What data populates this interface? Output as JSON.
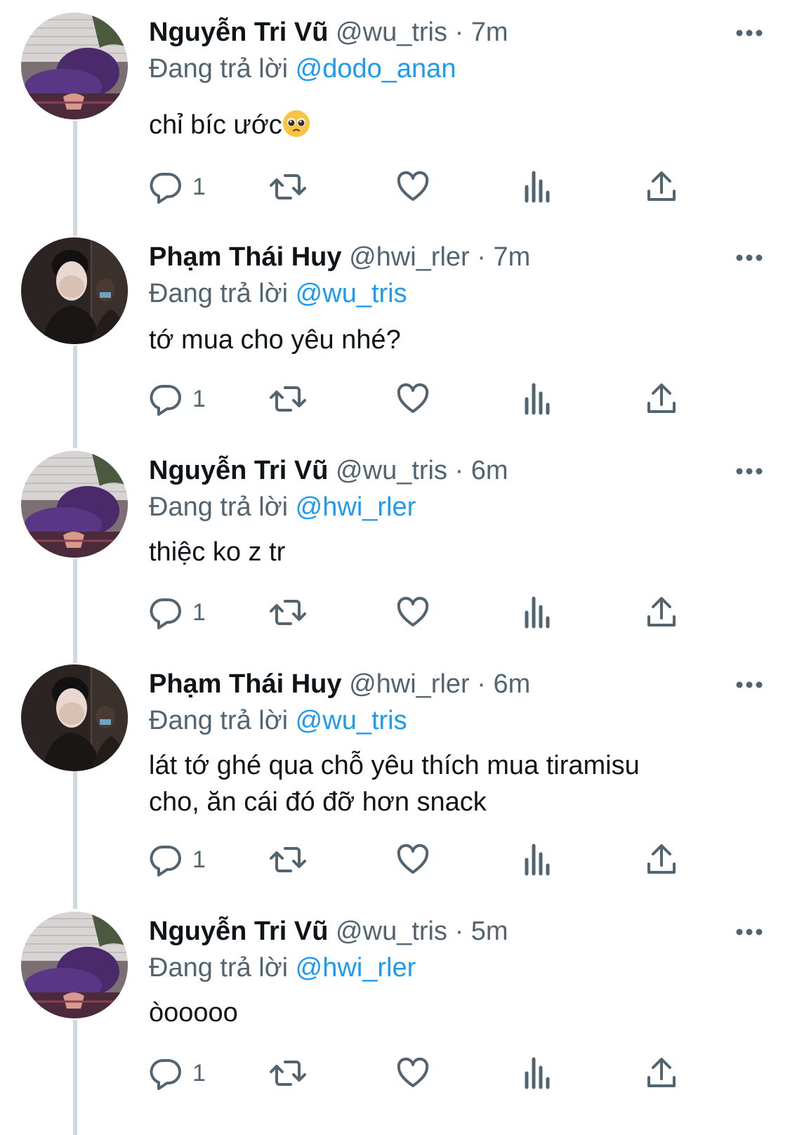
{
  "tweets": [
    {
      "name": "Nguyễn Tri Vũ",
      "handle": "@wu_tris",
      "dot": "·",
      "time": "7m",
      "reply_prefix": "Đang trả lời",
      "reply_to": "@dodo_anan",
      "text": "chỉ bíc ước",
      "emoji": "pleading-face-emoji",
      "replies": "1",
      "avatar": "purple-hoodie-avatar"
    },
    {
      "name": "Phạm Thái Huy",
      "handle": "@hwi_rler",
      "dot": "·",
      "time": "7m",
      "reply_prefix": "Đang trả lời",
      "reply_to": "@wu_tris",
      "text": "tớ mua cho yêu nhé?",
      "replies": "1",
      "avatar": "dark-portrait-avatar"
    },
    {
      "name": "Nguyễn Tri Vũ",
      "handle": "@wu_tris",
      "dot": "·",
      "time": "6m",
      "reply_prefix": "Đang trả lời",
      "reply_to": "@hwi_rler",
      "text": "thiệc ko z tr",
      "replies": "1",
      "avatar": "purple-hoodie-avatar"
    },
    {
      "name": "Phạm Thái Huy",
      "handle": "@hwi_rler",
      "dot": "·",
      "time": "6m",
      "reply_prefix": "Đang trả lời",
      "reply_to": "@wu_tris",
      "text_line1": "lát tớ ghé qua chỗ yêu thích mua tiramisu",
      "text_line2": "cho, ăn cái đó đỡ hơn snack",
      "replies": "1",
      "avatar": "dark-portrait-avatar"
    },
    {
      "name": "Nguyễn Tri Vũ",
      "handle": "@wu_tris",
      "dot": "·",
      "time": "5m",
      "reply_prefix": "Đang trả lời",
      "reply_to": "@hwi_rler",
      "text": "òooooo",
      "replies": "1",
      "avatar": "purple-hoodie-avatar"
    }
  ],
  "colors": {
    "text": "#0f1419",
    "secondary": "#536471",
    "accent": "#1d9bf0",
    "thread_line": "#cfd9de"
  },
  "icons": [
    "more-icon",
    "reply-icon",
    "retweet-icon",
    "like-icon",
    "views-icon",
    "share-icon"
  ]
}
